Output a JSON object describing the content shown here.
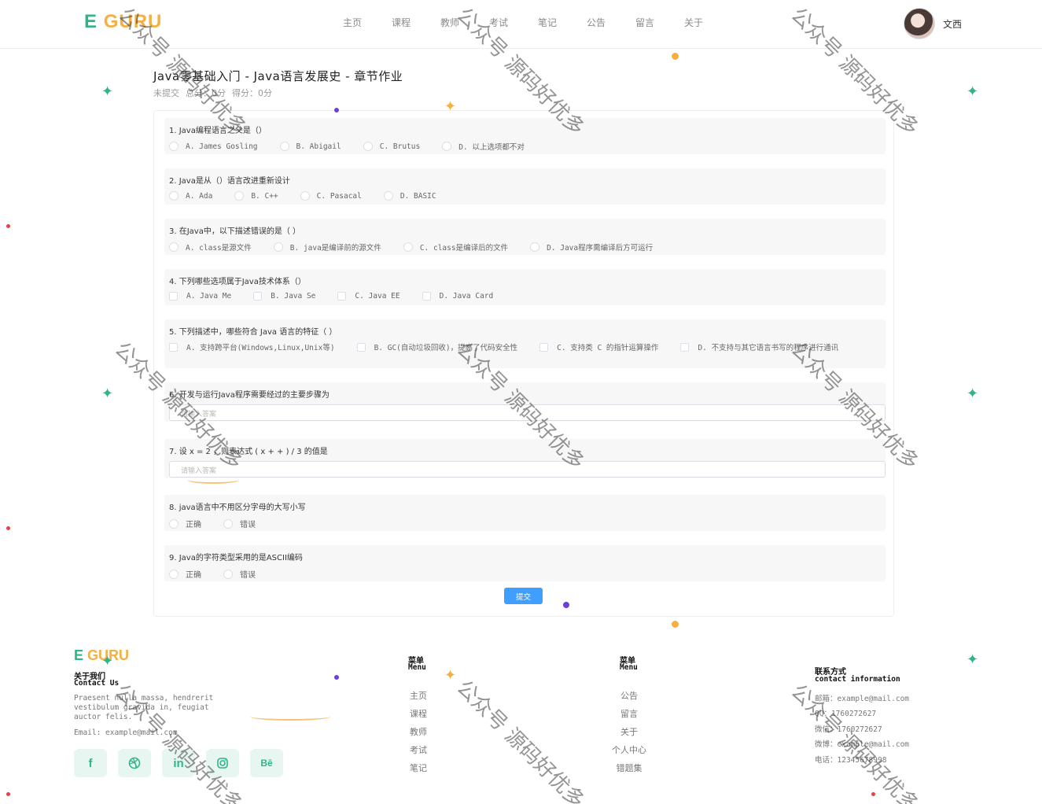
{
  "header": {
    "logo_e": "E",
    "logo_guru": "GURU",
    "nav": [
      "主页",
      "课程",
      "教师",
      "考试",
      "笔记",
      "公告",
      "留言",
      "关于"
    ],
    "username": "文西"
  },
  "exam": {
    "title": "Java零基础入门 - Java语言发展史 - 章节作业",
    "status": "未提交",
    "total": "总分：0分",
    "score": "得分：0分"
  },
  "questions": [
    {
      "text": "1. Java编程语言之父是（）",
      "options": [
        "A. James Gosling",
        "B. Abigail",
        "C. Brutus",
        "D. 以上选项都不对"
      ]
    },
    {
      "text": "2. Java是从（）语言改进重新设计",
      "options": [
        "A. Ada",
        "B. C++",
        "C. Pasacal",
        "D. BASIC"
      ]
    },
    {
      "text": "3. 在Java中，以下描述错误的是（ ）",
      "options": [
        "A. class是源文件",
        "B. java是编译前的源文件",
        "C. class是编译后的文件",
        "D. Java程序需编译后方可运行"
      ]
    },
    {
      "text": "4. 下列哪些选项属于Java技术体系（）",
      "options": [
        "A. Java Me",
        "B. Java Se",
        "C. Java EE",
        "D. Java Card"
      ]
    },
    {
      "text": "5. 下列描述中，哪些符合 Java 语言的特征（ ）",
      "options": [
        "A. 支持跨平台(Windows,Linux,Unix等)",
        "B. GC(自动垃圾回收)，提高了代码安全性",
        "C. 支持类 C 的指针运算操作",
        "D. 不支持与其它语言书写的程序进行通讯"
      ]
    },
    {
      "text": "6. 开发与运行Java程序需要经过的主要步骤为",
      "placeholder": "请输入答案"
    },
    {
      "text": "7. 设 x = 2 ，则表达式 ( x + + ) / 3 的值是",
      "placeholder": "请输入答案"
    },
    {
      "text": "8. java语言中不用区分字母的大写小写",
      "options": [
        "正确",
        "错误"
      ]
    },
    {
      "text": "9. Java的字符类型采用的是ASCII编码",
      "options": [
        "正确",
        "错误"
      ]
    }
  ],
  "submit_label": "提交",
  "footer": {
    "logo_e": "E",
    "logo_guru": "GURU",
    "about_cn": "关于我们",
    "about_en": "Contact Us",
    "about_text": "Praesent nulla massa, hendrerit vestibulum gravida in, feugiat auctor felis.",
    "email": "Email: example@mail.com",
    "menu_cn": "菜单",
    "menu_en": "Menu",
    "menu1": [
      "主页",
      "课程",
      "教师",
      "考试",
      "笔记"
    ],
    "menu2": [
      "公告",
      "留言",
      "关于",
      "个人中心",
      "错题集"
    ],
    "contact_cn": "联系方式",
    "contact_en": "contact information",
    "contacts": [
      "邮箱：example@mail.com",
      "QQ：1760272627",
      "微信：1760272627",
      "微博：example@mail.com",
      "电话：12345678998"
    ],
    "socials": [
      "facebook-icon",
      "dribbble-icon",
      "linkedin-icon",
      "instagram-icon",
      "behance-icon"
    ]
  },
  "watermark": "公众号 源码好优多",
  "colors": {
    "brand_green": "#2fb589",
    "brand_orange": "#f5b041",
    "button_blue": "#409eff"
  }
}
